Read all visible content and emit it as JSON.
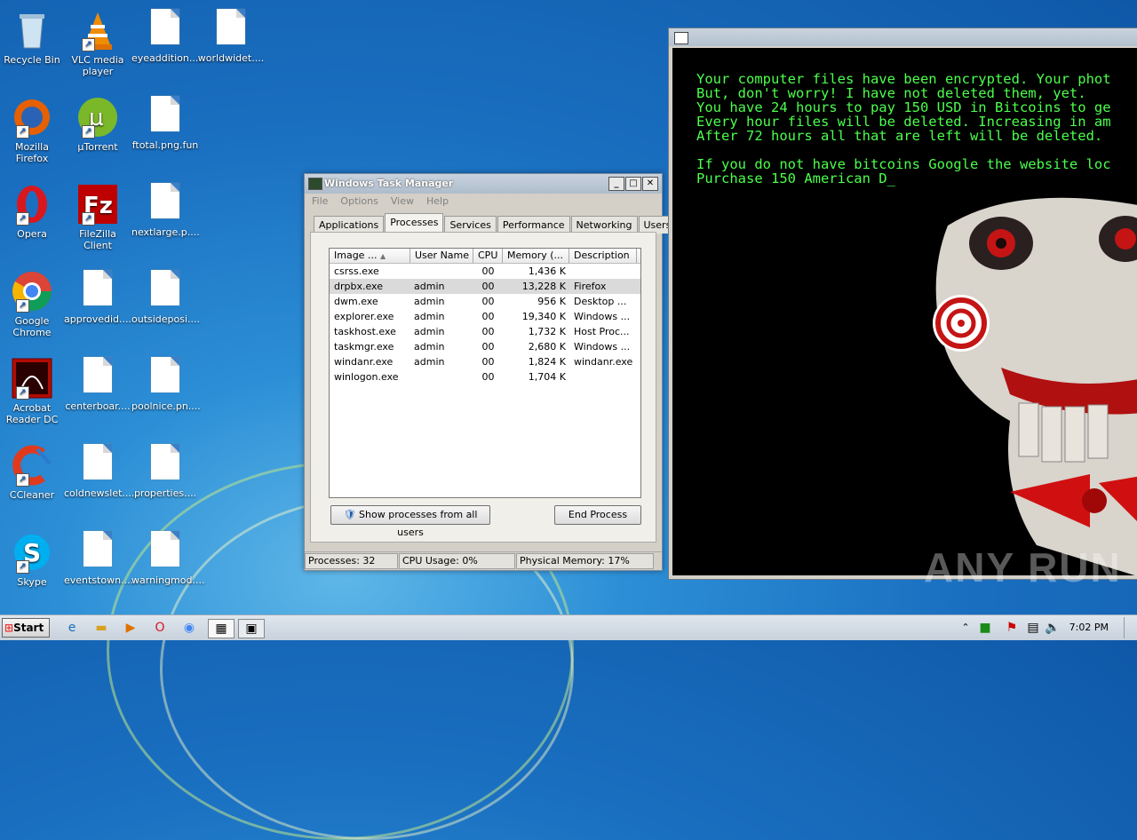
{
  "desktop": {
    "icons": [
      {
        "label": "Recycle Bin"
      },
      {
        "label": "VLC media player"
      },
      {
        "label": "eyeaddition...."
      },
      {
        "label": "worldwidet...."
      },
      {
        "label": "Mozilla Firefox"
      },
      {
        "label": "µTorrent"
      },
      {
        "label": "ftotal.png.fun"
      },
      {
        "label": "Opera"
      },
      {
        "label": "FileZilla Client"
      },
      {
        "label": "nextlarge.p...."
      },
      {
        "label": "Google Chrome"
      },
      {
        "label": "approvedid...."
      },
      {
        "label": "outsideposi...."
      },
      {
        "label": "Acrobat Reader DC"
      },
      {
        "label": "centerboar...."
      },
      {
        "label": "poolnice.pn...."
      },
      {
        "label": "CCleaner"
      },
      {
        "label": "coldnewslet...."
      },
      {
        "label": "properties...."
      },
      {
        "label": "Skype"
      },
      {
        "label": "eventstown...."
      },
      {
        "label": "warningmod...."
      }
    ]
  },
  "taskmgr": {
    "title": "Windows Task Manager",
    "menu": [
      "File",
      "Options",
      "View",
      "Help"
    ],
    "tabs": [
      "Applications",
      "Processes",
      "Services",
      "Performance",
      "Networking",
      "Users"
    ],
    "active_tab": "Processes",
    "columns": [
      "Image ...",
      "User Name",
      "CPU",
      "Memory (...",
      "Description"
    ],
    "rows": [
      {
        "image": "csrss.exe",
        "user": "",
        "cpu": "00",
        "mem": "1,436 K",
        "desc": ""
      },
      {
        "image": "drpbx.exe",
        "user": "admin",
        "cpu": "00",
        "mem": "13,228 K",
        "desc": "Firefox"
      },
      {
        "image": "dwm.exe",
        "user": "admin",
        "cpu": "00",
        "mem": "956 K",
        "desc": "Desktop ..."
      },
      {
        "image": "explorer.exe",
        "user": "admin",
        "cpu": "00",
        "mem": "19,340 K",
        "desc": "Windows ..."
      },
      {
        "image": "taskhost.exe",
        "user": "admin",
        "cpu": "00",
        "mem": "1,732 K",
        "desc": "Host Proc..."
      },
      {
        "image": "taskmgr.exe",
        "user": "admin",
        "cpu": "00",
        "mem": "2,680 K",
        "desc": "Windows ..."
      },
      {
        "image": "windanr.exe",
        "user": "admin",
        "cpu": "00",
        "mem": "1,824 K",
        "desc": "windanr.exe"
      },
      {
        "image": "winlogon.exe",
        "user": "",
        "cpu": "00",
        "mem": "1,704 K",
        "desc": ""
      }
    ],
    "show_all_label": "Show processes from all users",
    "end_process_label": "End Process",
    "status": {
      "processes": "Processes: 32",
      "cpu": "CPU Usage: 0%",
      "memory": "Physical Memory: 17%"
    }
  },
  "ransom": {
    "lines": [
      "Your computer files have been encrypted. Your phot",
      "But, don't worry! I have not deleted them, yet.",
      "You have 24 hours to pay 150 USD in Bitcoins to ge",
      "Every hour files will be deleted. Increasing in am",
      "After 72 hours all that are left will be deleted.",
      "",
      "If you do not have bitcoins Google the website loc",
      "Purchase 150 American D_"
    ],
    "text_color": "#4cff4c"
  },
  "watermark": "ANY RUN",
  "taskbar": {
    "start_label": "Start",
    "clock": "7:02 PM"
  }
}
